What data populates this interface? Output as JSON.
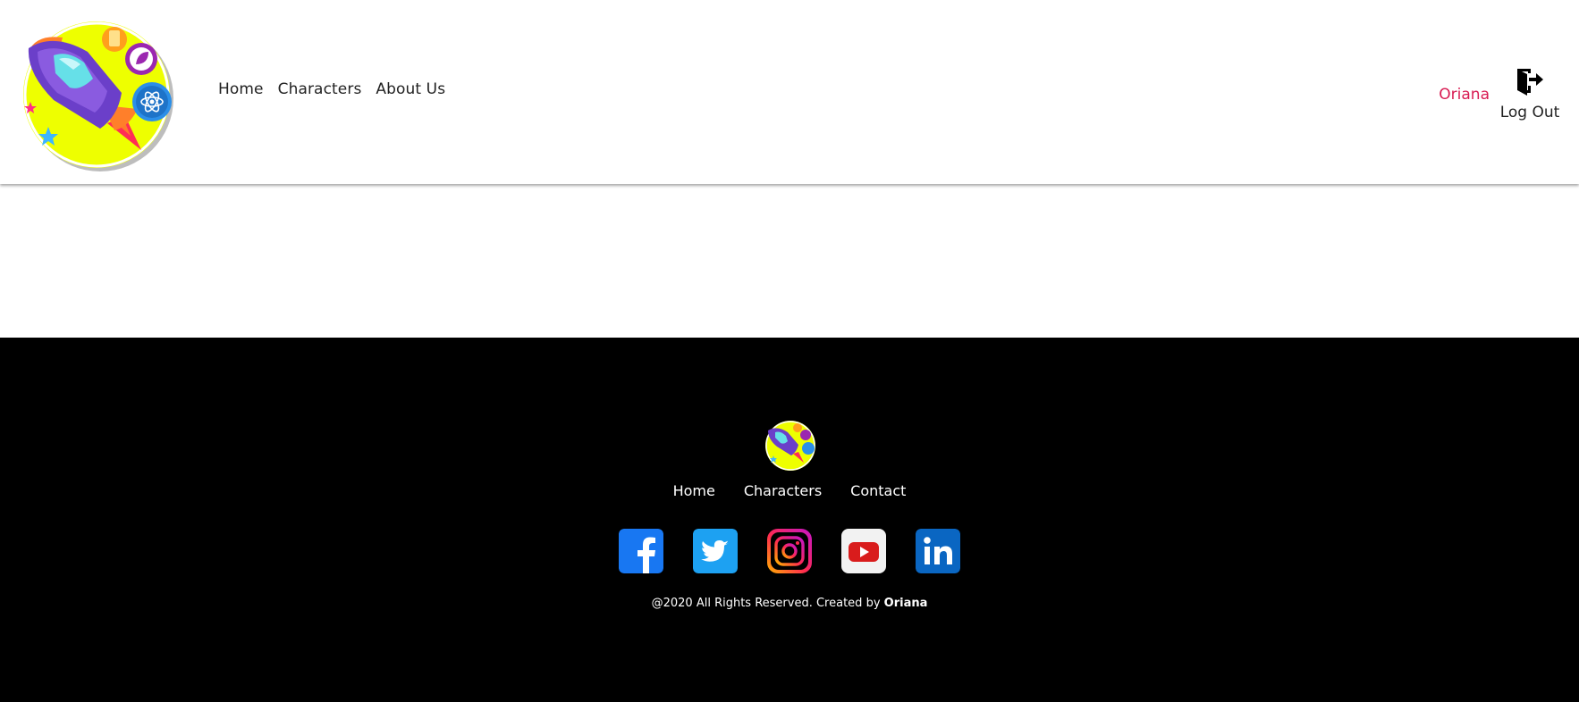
{
  "header": {
    "nav": [
      {
        "label": "Home"
      },
      {
        "label": "Characters"
      },
      {
        "label": "About Us"
      }
    ],
    "user": {
      "name": "Oriana",
      "color": "#d81b52"
    },
    "logout": {
      "label": "Log Out",
      "icon": "logout-door-icon"
    }
  },
  "footer": {
    "nav": [
      {
        "label": "Home"
      },
      {
        "label": "Characters"
      },
      {
        "label": "Contact"
      }
    ],
    "socials": [
      {
        "name": "facebook-icon"
      },
      {
        "name": "twitter-icon"
      },
      {
        "name": "instagram-icon"
      },
      {
        "name": "youtube-icon"
      },
      {
        "name": "linkedin-icon"
      }
    ],
    "copyright_prefix": "@2020 All Rights Reserved. Created by ",
    "copyright_author": "Oriana"
  },
  "colors": {
    "footer_bg": "#000000",
    "logo_yellow": "#eeff00",
    "rocket_purple": "#6b3fc9"
  }
}
